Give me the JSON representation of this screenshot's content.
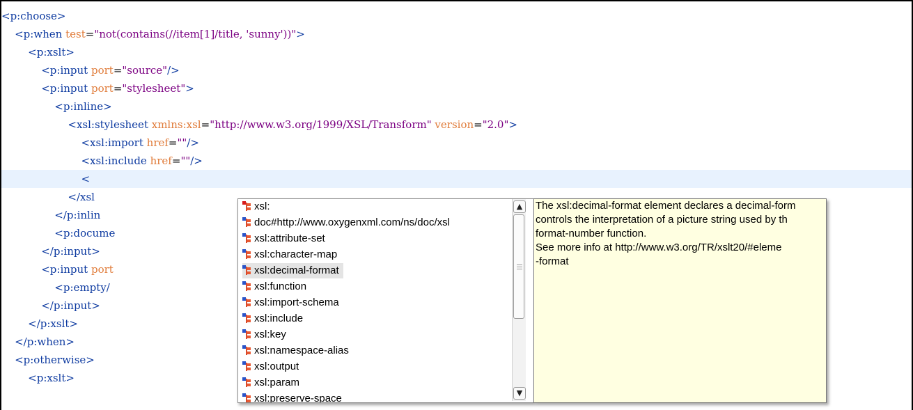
{
  "editor": {
    "lines": [
      {
        "indent": "",
        "tag": "<p:choose>"
      },
      {
        "indent": "    ",
        "tag": "<p:when",
        "attr": "test",
        "value": "\"not(contains(//item[1]/title, 'sunny'))\"",
        "close": ">"
      },
      {
        "indent": "        ",
        "tag": "<p:xslt>"
      },
      {
        "indent": "            ",
        "tag": "<p:input",
        "attr": "port",
        "value": "\"source\"",
        "close": "/>"
      },
      {
        "indent": "            ",
        "tag": "<p:input",
        "attr": "port",
        "value": "\"stylesheet\"",
        "close": ">"
      },
      {
        "indent": "                ",
        "tag": "<p:inline>"
      },
      {
        "indent": "                    ",
        "tag": "<xsl:stylesheet",
        "attr": "xmlns:xsl",
        "value": "\"http://www.w3.org/1999/XSL/Transform\"",
        "attr2": "version",
        "value2": "\"2.0\"",
        "close": ">"
      },
      {
        "indent": "                        ",
        "tag": "<xsl:import",
        "attr": "href",
        "value": "\"\"",
        "close": "/>"
      },
      {
        "indent": "                        ",
        "tag": "<xsl:include",
        "attr": "href",
        "value": "\"\"",
        "close": "/>"
      },
      {
        "indent": "                        ",
        "tag": "<"
      },
      {
        "indent": "                    ",
        "tag": "</xsl"
      },
      {
        "indent": "                ",
        "tag": "</p:inlin"
      },
      {
        "indent": "                ",
        "tag": "<p:docume"
      },
      {
        "indent": "            ",
        "tag": "</p:input>"
      },
      {
        "indent": "            ",
        "tag": "<p:input",
        "attr": "port"
      },
      {
        "indent": "                ",
        "tag": "<p:empty/"
      },
      {
        "indent": "            ",
        "tag": "</p:input>"
      },
      {
        "indent": "        ",
        "tag": "</p:xslt>"
      },
      {
        "indent": "    ",
        "tag": "</p:when>"
      },
      {
        "indent": "    ",
        "tag": "<p:otherwise>"
      },
      {
        "indent": "        ",
        "tag": "<p:xslt>"
      }
    ],
    "current_line": 9
  },
  "completion": {
    "items": [
      "xsl:",
      "doc#http://www.oxygenxml.com/ns/doc/xsl",
      "xsl:attribute-set",
      "xsl:character-map",
      "xsl:decimal-format",
      "xsl:function",
      "xsl:import-schema",
      "xsl:include",
      "xsl:key",
      "xsl:namespace-alias",
      "xsl:output",
      "xsl:param",
      "xsl:preserve-space"
    ],
    "selected_index": 4,
    "first_icon_color": "#d81b1b",
    "item_icon": "element-tree-icon",
    "scroll_up_icon": "chevron-up-icon",
    "scroll_down_icon": "chevron-down-icon"
  },
  "documentation": {
    "lines": [
      "The xsl:decimal-format element declares a decimal-form",
      "controls the interpretation of a picture string used by th",
      "format-number function.",
      "See more info at http://www.w3.org/TR/xslt20/#eleme",
      "-format"
    ],
    "background": "#ffffe1"
  },
  "colors": {
    "tag": "#0d3aa0",
    "attribute": "#e07b39",
    "value": "#8a1a7b",
    "current_line": "#e8f2fe"
  }
}
